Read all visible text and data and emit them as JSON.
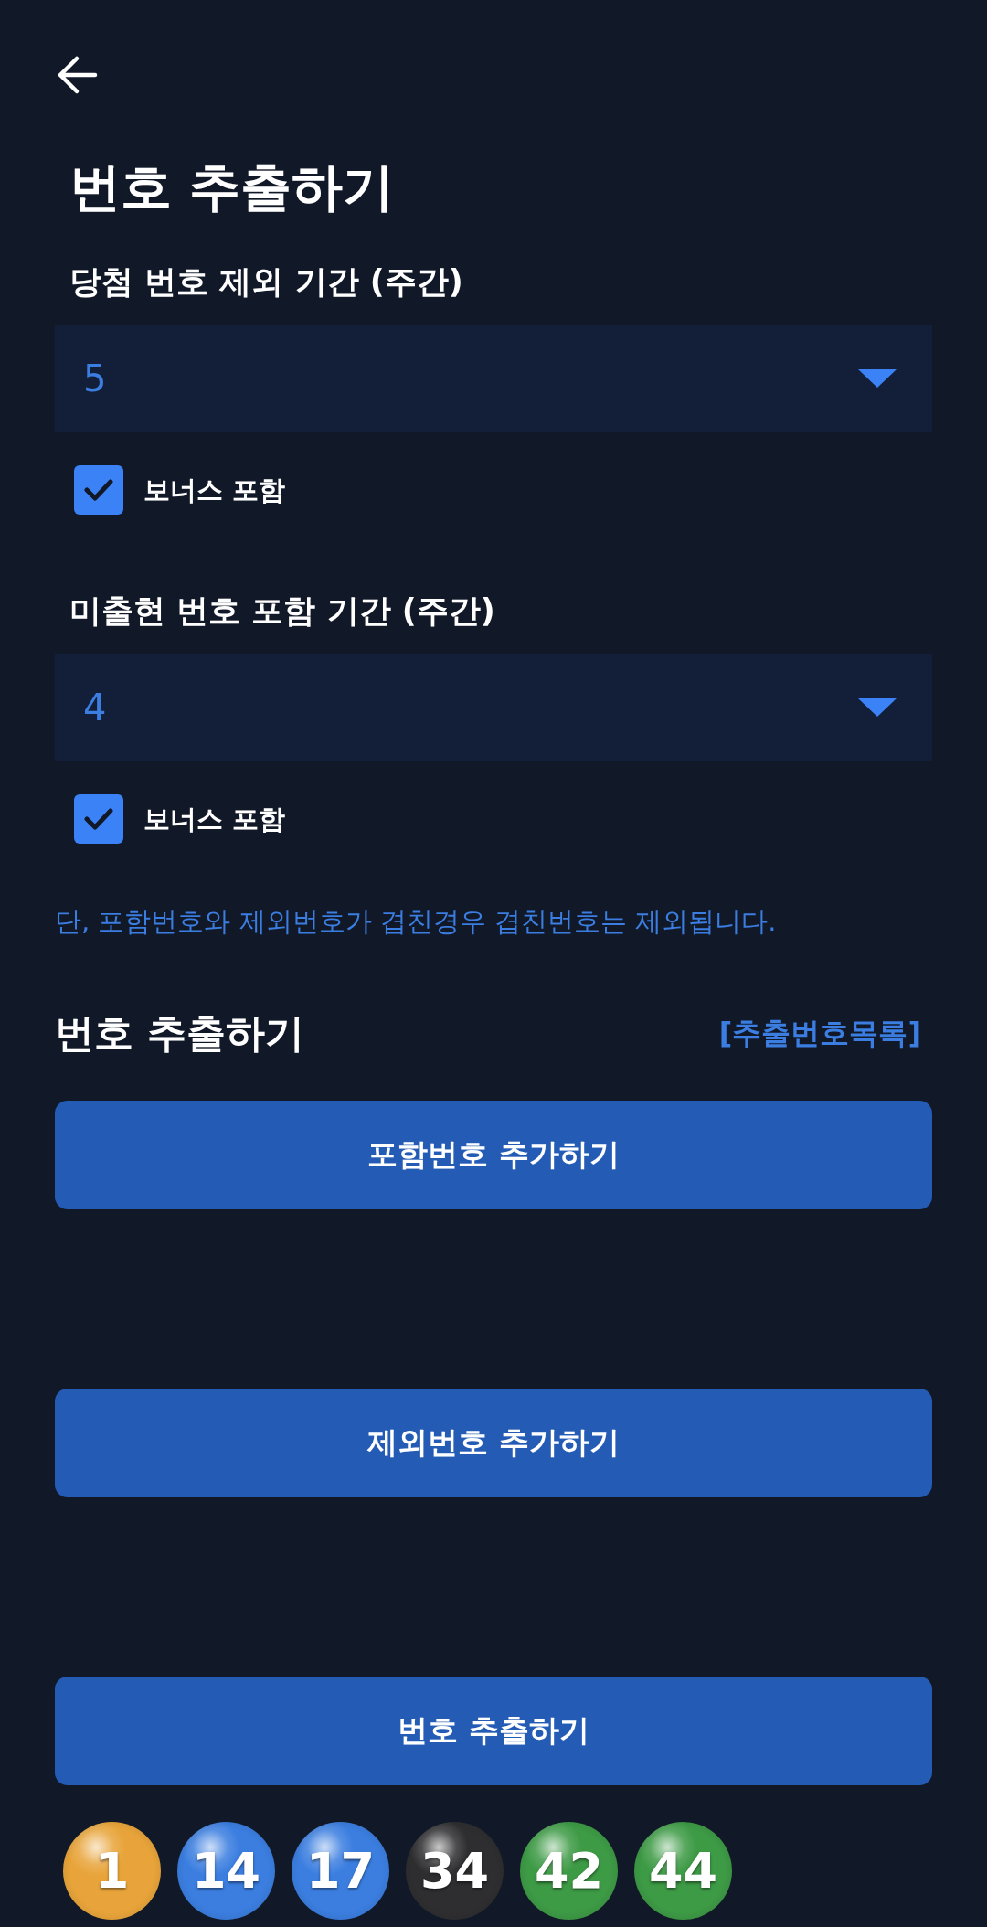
{
  "header": {
    "title": "번호 추출하기"
  },
  "periods": [
    {
      "label": "당첨 번호 제외 기간 (주간)",
      "value": "5",
      "bonus": {
        "label": "보너스 포함",
        "checked": true
      }
    },
    {
      "label": "미출현 번호 포함 기간 (주간)",
      "value": "4",
      "bonus": {
        "label": "보너스 포함",
        "checked": true
      }
    }
  ],
  "note": "단, 포함번호와 제외번호가 겹친경우 겹친번호는 제외됩니다.",
  "extract": {
    "title": "번호 추출하기",
    "list_link": "[추출번호목록]",
    "buttons": [
      "포함번호 추가하기",
      "제외번호 추가하기",
      "번호 추출하기"
    ]
  },
  "balls": [
    {
      "number": "1",
      "color": "#e8a43a"
    },
    {
      "number": "14",
      "color": "#3b7ee0"
    },
    {
      "number": "17",
      "color": "#3b7ee0"
    },
    {
      "number": "34",
      "color": "#2e2e30"
    },
    {
      "number": "42",
      "color": "#3d9a45"
    },
    {
      "number": "44",
      "color": "#3d9a45"
    }
  ]
}
